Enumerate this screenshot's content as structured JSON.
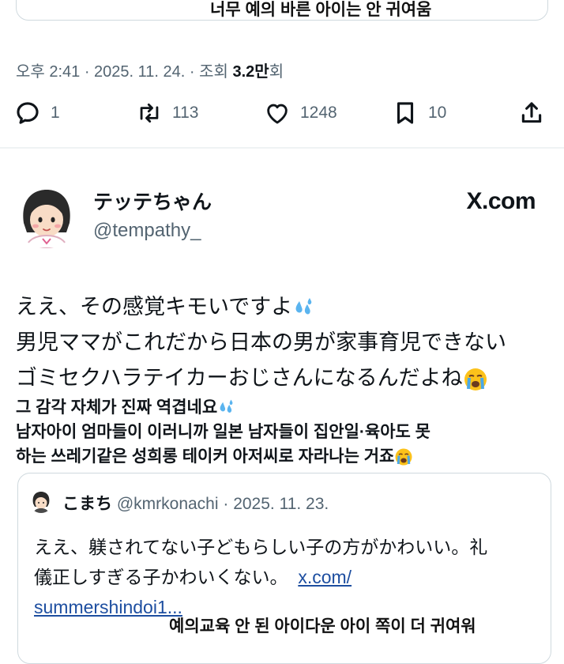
{
  "top_caption": "너무 예의 바른 아이는 안 귀여움",
  "meta": {
    "time_date": "오후 2:41 · 2025. 11. 24. · 조회 ",
    "views": "3.2만",
    "views_suffix": "회"
  },
  "actions": {
    "replies": "1",
    "reposts": "113",
    "likes": "1248",
    "bookmarks": "10"
  },
  "tweet": {
    "display_name": "テッテちゃん",
    "handle": "@tempathy_",
    "brand": "X.com",
    "lines": [
      "ええ、その感覚キモいですよ",
      "男児ママがこれだから日本の男が家事育児できない",
      "ゴミセクハラテイカーおじさんになるんだよね"
    ]
  },
  "translation": {
    "lines": [
      "그 감각 자체가 진짜 역겹네요",
      "남자아이 엄마들이 이러니까 일본 남자들이 집안일·육아도 못",
      "하는 쓰레기같은 성희롱 테이커 아저씨로 자라나는 거죠"
    ]
  },
  "quoted": {
    "display_name": "こまち",
    "handle_date": "@kmrkonachi · 2025. 11. 23.",
    "line1": "ええ、躾されてない子どもらしい子の方がかわいい。礼",
    "line2_text": "儀正しすぎる子かわいくない。",
    "link1": "x.com/",
    "link2": "summershindoi1..."
  },
  "bottom_caption": "예의교육 안 된 아이다운 아이 쪽이 더 귀여워",
  "colors": {
    "text": "#0f1419",
    "secondary": "#536471",
    "border": "#cfd9de",
    "link": "#1d4ea0"
  }
}
